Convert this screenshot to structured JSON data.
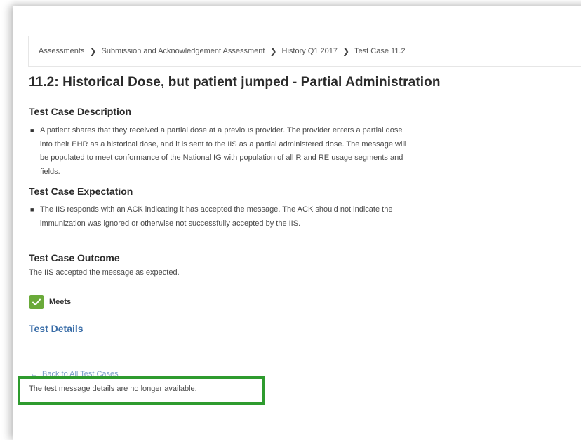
{
  "breadcrumb": {
    "items": [
      "Assessments",
      "Submission and Acknowledgement Assessment",
      "History Q1 2017",
      "Test Case 11.2"
    ],
    "separator": "❯"
  },
  "page": {
    "title": "11.2: Historical Dose, but patient jumped - Partial Administration"
  },
  "description": {
    "heading": "Test Case Description",
    "text": "A patient shares that they received a partial dose at a previous provider. The provider enters a partial dose into their EHR as a historical dose, and it is sent to the IIS as a partial administered dose. The message will be populated to meet conformance of the National IG with population of all R and RE usage segments and fields."
  },
  "expectation": {
    "heading": "Test Case Expectation",
    "text": "The IIS responds with an ACK indicating it has accepted the message. The ACK should not indicate the immunization was ignored or otherwise not successfully accepted by the IIS."
  },
  "outcome": {
    "heading": "Test Case Outcome",
    "text": "The IIS accepted the message as expected.",
    "status_label": "Meets",
    "status_color": "#6aaa3a"
  },
  "links": {
    "test_details": "Test Details",
    "back": "Back to All Test Cases"
  },
  "notice": {
    "text": "The test message details are no longer available.",
    "highlight_color": "#2e9b2e"
  }
}
